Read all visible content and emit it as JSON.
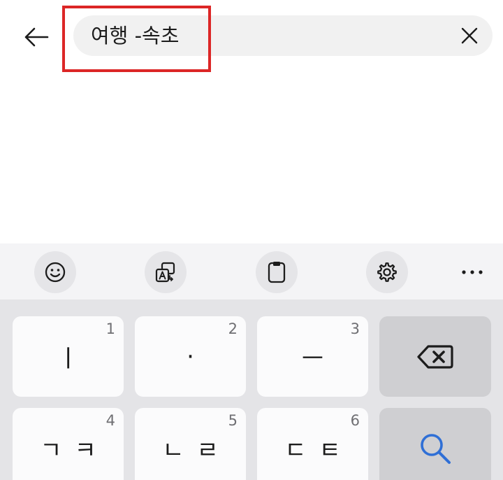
{
  "header": {
    "back_icon": "arrow-left-icon",
    "search_query": "여행 -속초",
    "clear_icon": "close-icon"
  },
  "toolbar": {
    "items": [
      {
        "icon": "emoji-icon"
      },
      {
        "icon": "translate-icon"
      },
      {
        "icon": "clipboard-icon"
      },
      {
        "icon": "gear-icon"
      },
      {
        "icon": "more-horizontal-icon"
      }
    ]
  },
  "keyboard": {
    "keys": [
      {
        "num": "1",
        "label": "ㅣ"
      },
      {
        "num": "2",
        "label": "·"
      },
      {
        "num": "3",
        "label": "ㅡ"
      },
      {
        "icon": "backspace-icon"
      },
      {
        "num": "4",
        "label": "ㄱㅋ"
      },
      {
        "num": "5",
        "label": "ㄴㄹ"
      },
      {
        "num": "6",
        "label": "ㄷㅌ"
      },
      {
        "icon": "search-icon"
      }
    ]
  },
  "colors": {
    "highlight": "#dc2626",
    "search_accent": "#2f6fd6"
  }
}
